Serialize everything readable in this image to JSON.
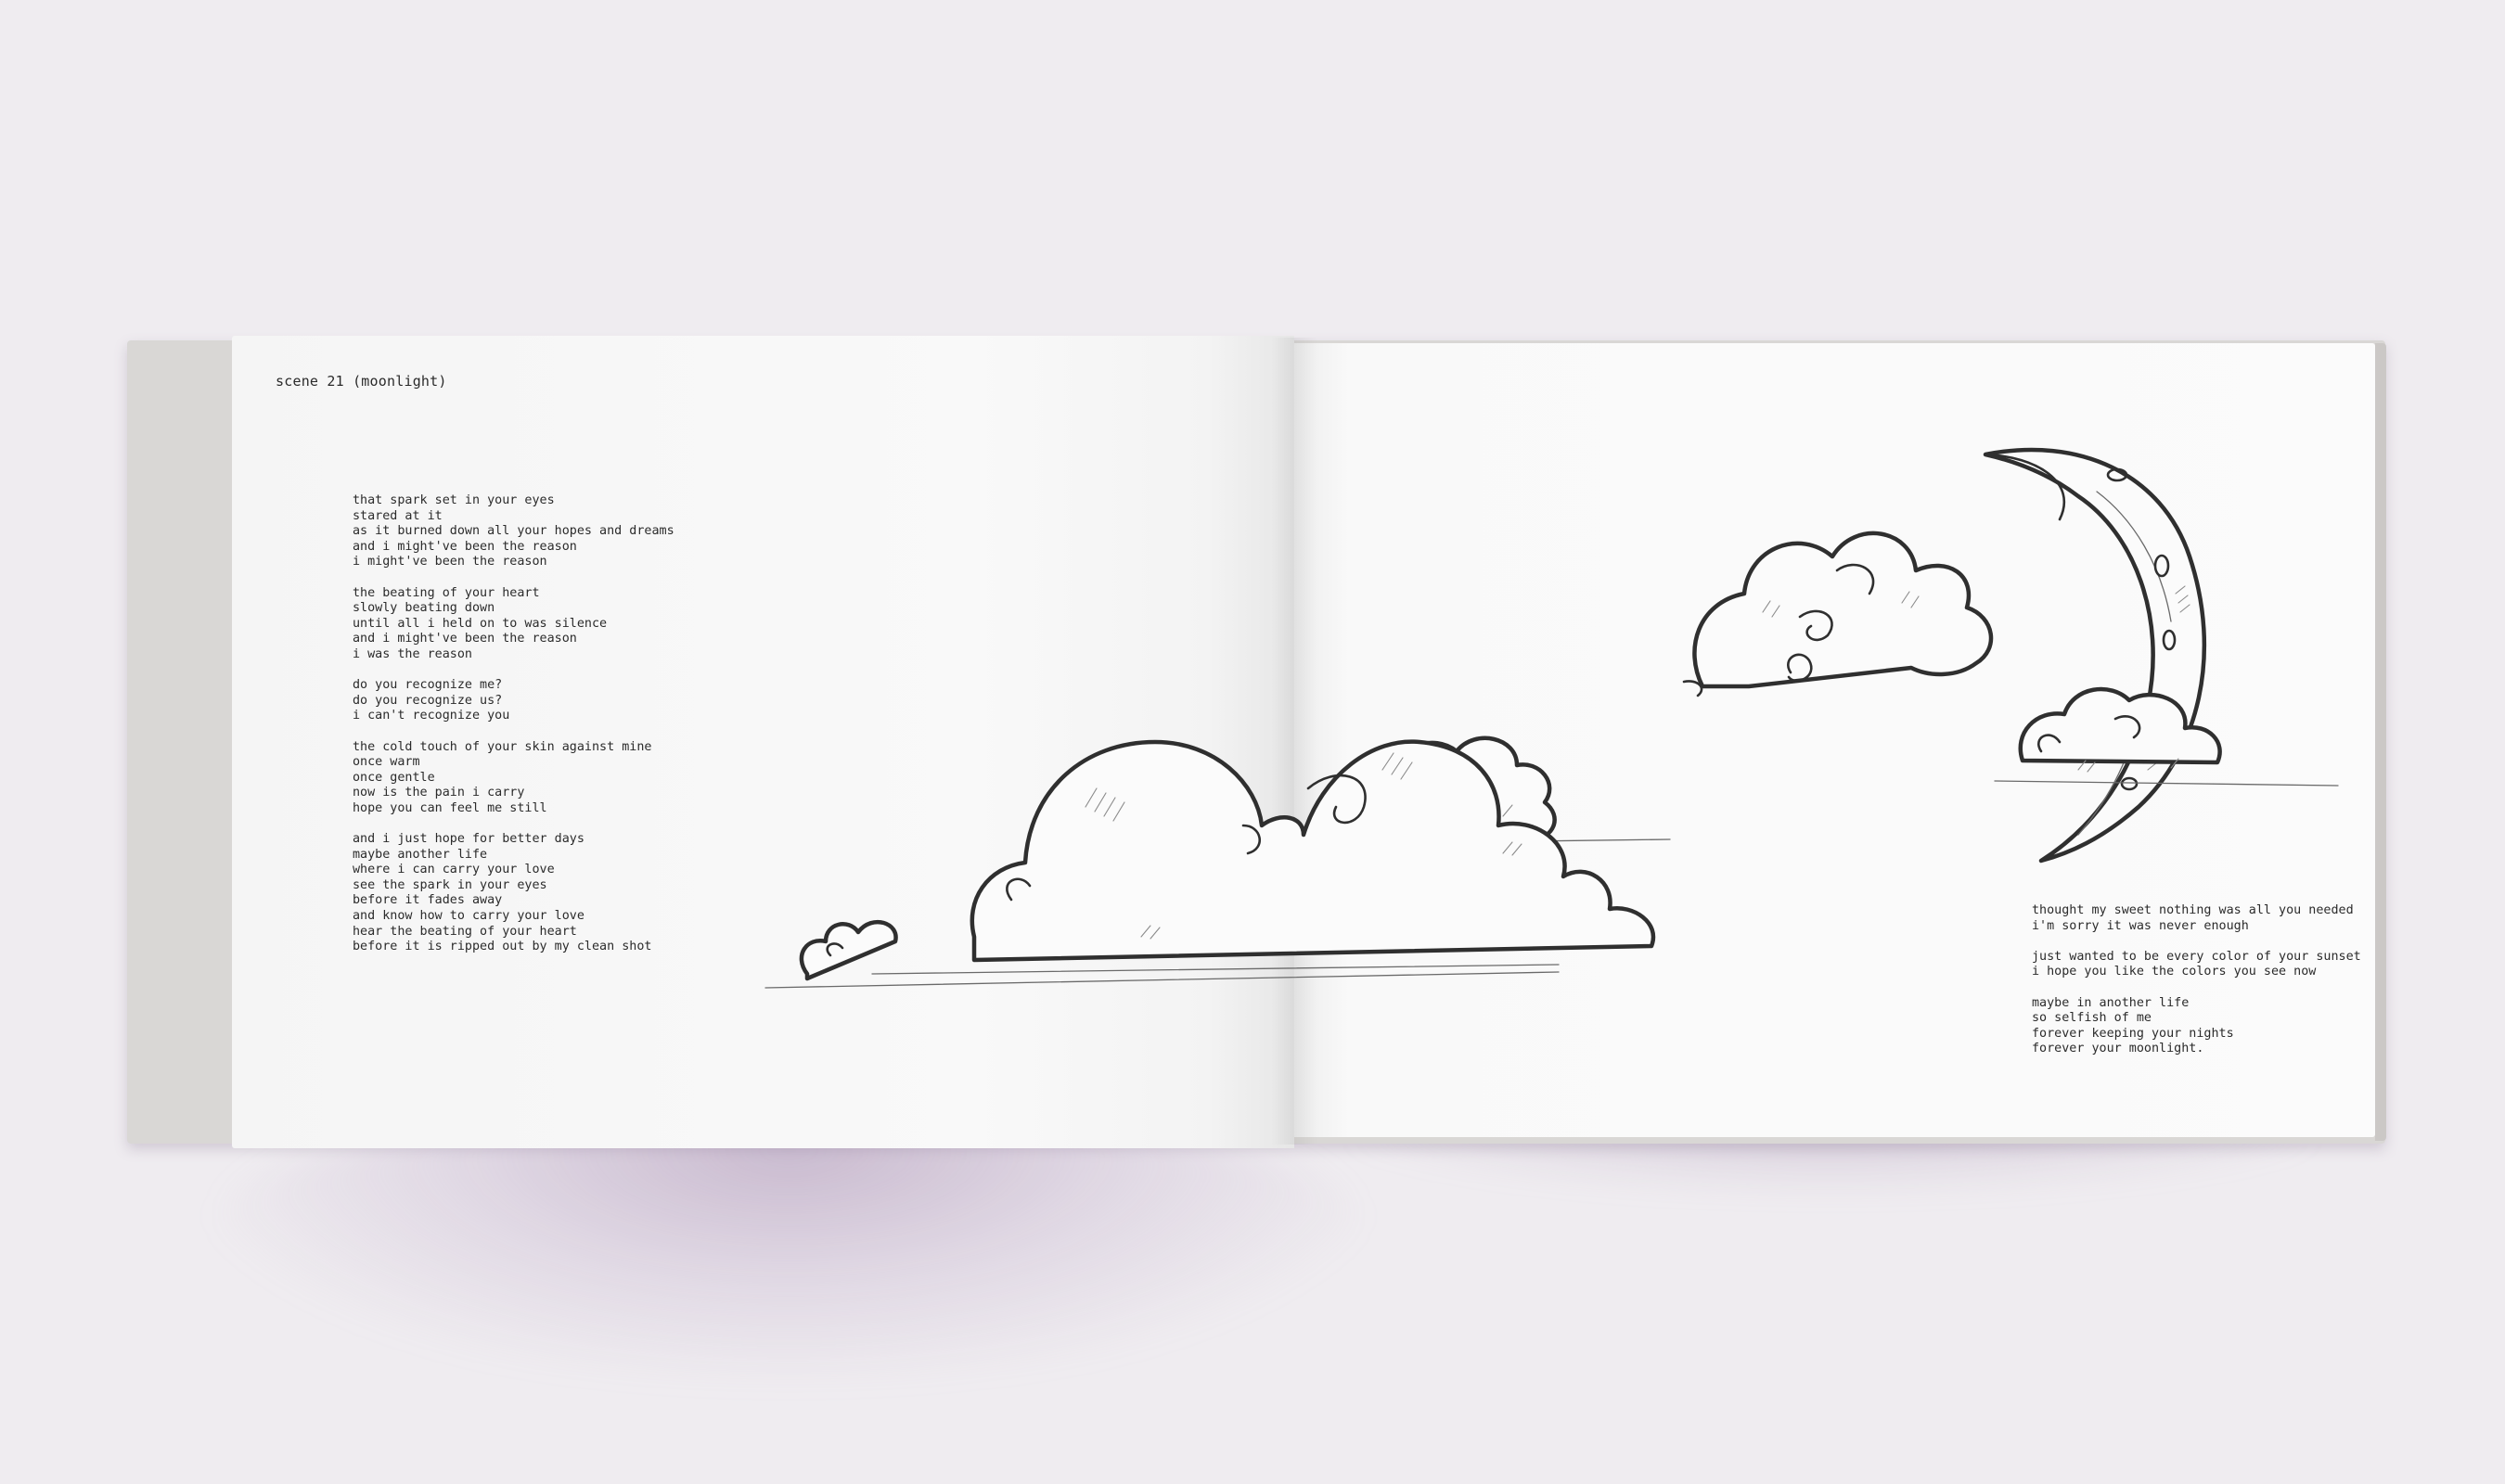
{
  "book": {
    "scene_title": "scene 21 (moonlight)",
    "left_poem": [
      [
        "that spark set in your eyes",
        "stared at it",
        "as it burned down all your hopes and dreams",
        "and i might've been the reason",
        "i might've been the reason"
      ],
      [
        "the beating of your heart",
        "slowly beating down",
        "until all i held on to was silence",
        "and i might've been the reason",
        "i was the reason"
      ],
      [
        "do you recognize me?",
        "do you recognize us?",
        "i can't recognize you"
      ],
      [
        "the cold touch of your skin against mine",
        "once warm",
        "once gentle",
        "now is the pain i carry",
        "hope you can feel me still"
      ],
      [
        "and i just hope for better days",
        "maybe another life",
        "where i can carry your love",
        "see the spark in your eyes",
        "before it fades away",
        "and know how to carry your love",
        "hear the beating of your heart",
        "before it is ripped out by my clean shot"
      ]
    ],
    "right_poem": [
      [
        "thought my sweet nothing was all you needed",
        "i'm sorry it was never enough"
      ],
      [
        "just wanted to be every color of your sunset",
        "i hope you like the colors you see now"
      ],
      [
        "maybe in another life",
        "so selfish of me",
        "forever keeping your nights",
        "forever your moonlight."
      ]
    ]
  },
  "illustration": {
    "subject": "hand-drawn clouds and crescent-moon",
    "stroke_color": "#2f2f2f",
    "page_color": "#f9f9f9",
    "background_color": "#efecf0",
    "cover_color": "#d9d7d5"
  }
}
